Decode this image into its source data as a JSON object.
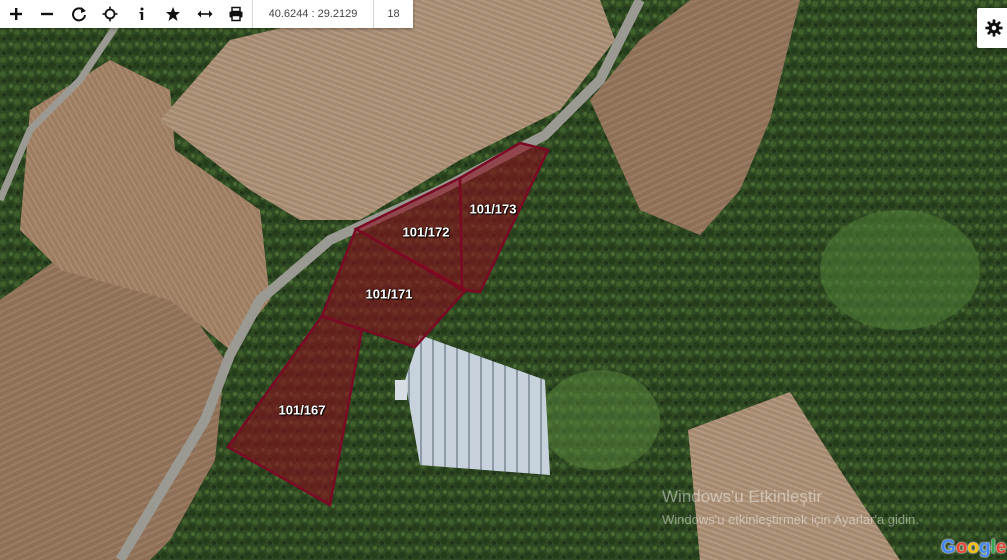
{
  "toolbar": {
    "buttons": [
      {
        "icon": "plus-icon"
      },
      {
        "icon": "minus-icon"
      },
      {
        "icon": "refresh-icon"
      },
      {
        "icon": "crosshair-icon"
      },
      {
        "icon": "info-icon"
      },
      {
        "icon": "star-icon"
      },
      {
        "icon": "measure-icon"
      },
      {
        "icon": "print-icon"
      }
    ],
    "coordinates": "40.6244 : 29.2129",
    "zoom_level": "18"
  },
  "settings": {
    "icon": "gear-icon"
  },
  "parcels": [
    {
      "label": "101/167"
    },
    {
      "label": "101/171"
    },
    {
      "label": "101/172"
    },
    {
      "label": "101/173"
    }
  ],
  "parcel_style": {
    "fill": "#8a0f1e",
    "stroke": "#7a0a24"
  },
  "watermark": {
    "line1": "Windows'u Etkinleştir",
    "line2": "Windows'u etkinleştirmek için Ayarlar'a gidin."
  },
  "attribution": {
    "logo": "Google"
  }
}
